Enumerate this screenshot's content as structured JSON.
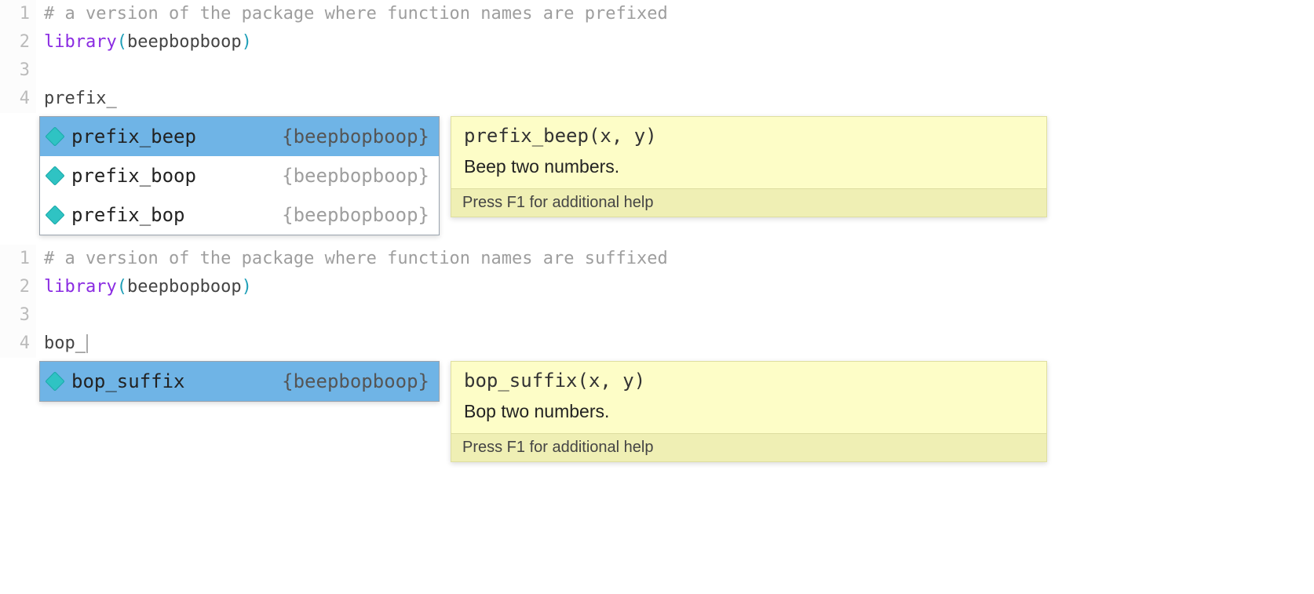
{
  "blocks": [
    {
      "lines": [
        {
          "num": "1",
          "tokens": [
            {
              "t": "comment",
              "v": "# a version of the package where function names are prefixed"
            }
          ]
        },
        {
          "num": "2",
          "tokens": [
            {
              "t": "keyword",
              "v": "library"
            },
            {
              "t": "paren",
              "v": "("
            },
            {
              "t": "pkg",
              "v": "beepbopboop"
            },
            {
              "t": "paren",
              "v": ")"
            }
          ]
        },
        {
          "num": "3",
          "tokens": []
        },
        {
          "num": "4",
          "tokens": [
            {
              "t": "text",
              "v": "prefix_"
            }
          ],
          "cursor": false
        }
      ],
      "autocomplete": {
        "items": [
          {
            "name": "prefix_beep",
            "pkg": "{beepbopboop}",
            "selected": true
          },
          {
            "name": "prefix_boop",
            "pkg": "{beepbopboop}",
            "selected": false
          },
          {
            "name": "prefix_bop",
            "pkg": "{beepbopboop}",
            "selected": false
          }
        ],
        "tooltip": {
          "signature": "prefix_beep(x, y)",
          "description": "Beep two numbers.",
          "footer": "Press F1 for additional help"
        }
      }
    },
    {
      "lines": [
        {
          "num": "1",
          "tokens": [
            {
              "t": "comment",
              "v": "# a version of the package where function names are suffixed"
            }
          ]
        },
        {
          "num": "2",
          "tokens": [
            {
              "t": "keyword",
              "v": "library"
            },
            {
              "t": "paren",
              "v": "("
            },
            {
              "t": "pkg",
              "v": "beepbopboop"
            },
            {
              "t": "paren",
              "v": ")"
            }
          ]
        },
        {
          "num": "3",
          "tokens": []
        },
        {
          "num": "4",
          "tokens": [
            {
              "t": "text",
              "v": "bop_"
            }
          ],
          "cursor": true
        }
      ],
      "autocomplete": {
        "items": [
          {
            "name": "bop_suffix",
            "pkg": "{beepbopboop}",
            "selected": true
          }
        ],
        "tooltip": {
          "signature": "bop_suffix(x, y)",
          "description": "Bop two numbers.",
          "footer": "Press F1 for additional help"
        }
      }
    }
  ]
}
